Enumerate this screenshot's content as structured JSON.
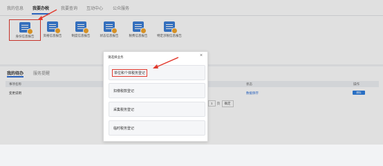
{
  "top_tabs": [
    {
      "label": "我的信息",
      "active": false
    },
    {
      "label": "我要办税",
      "active": true
    },
    {
      "label": "我要查询",
      "active": false
    },
    {
      "label": "互动中心",
      "active": false
    },
    {
      "label": "公众服务",
      "active": false
    }
  ],
  "tools": [
    {
      "label": "身份信息报告",
      "selected": true
    },
    {
      "label": "资格信息报告",
      "selected": false
    },
    {
      "label": "制度信息报告",
      "selected": false
    },
    {
      "label": "状态信息报告",
      "selected": false
    },
    {
      "label": "税费信息报告",
      "selected": false
    },
    {
      "label": "特定涉税信息报告",
      "selected": false
    }
  ],
  "panel": {
    "tabs": [
      {
        "label": "我的待办",
        "active": true
      },
      {
        "label": "服务提醒",
        "active": false
      }
    ],
    "table": {
      "columns": [
        "事项名称",
        "状态",
        "操作"
      ],
      "rows": [
        {
          "name": "变更说明",
          "status": "数据保存",
          "action": "删除"
        }
      ]
    },
    "pager": {
      "page": "1",
      "unit": "页",
      "confirm": "确定"
    }
  },
  "modal": {
    "title": "请选择业务",
    "close": "×",
    "options": [
      {
        "label": "单位和个体税务登记",
        "selected": true
      },
      {
        "label": "扣缴税款登记",
        "selected": false
      },
      {
        "label": "采集税务登记",
        "selected": false
      },
      {
        "label": "临时税务登记",
        "selected": false
      }
    ]
  },
  "colors": {
    "accent": "#2f6fd6",
    "highlight": "#e23a2e",
    "icon": "#3c7fd8"
  }
}
